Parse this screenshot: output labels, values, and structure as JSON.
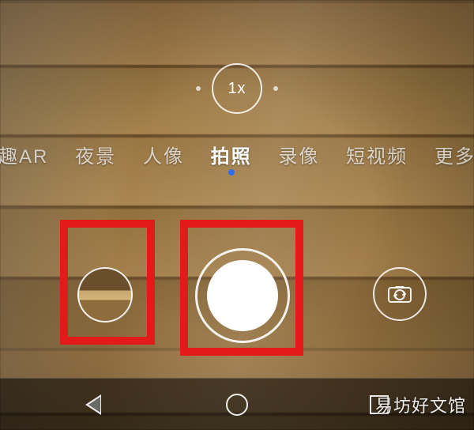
{
  "zoom": {
    "label": "1x"
  },
  "modes": [
    {
      "label": "趣AR",
      "active": false
    },
    {
      "label": "夜景",
      "active": false
    },
    {
      "label": "人像",
      "active": false
    },
    {
      "label": "拍照",
      "active": true
    },
    {
      "label": "录像",
      "active": false
    },
    {
      "label": "短视频",
      "active": false
    },
    {
      "label": "更多",
      "active": false
    }
  ],
  "icons": {
    "switch_camera": "switch-camera-icon",
    "gallery": "gallery-thumbnail",
    "shutter": "shutter-button",
    "nav_back": "back",
    "nav_home": "home",
    "nav_recent": "recent"
  },
  "colors": {
    "highlight_box": "#e21a1a",
    "active_dot": "#2f6df0"
  },
  "watermark": "易坊好文馆"
}
